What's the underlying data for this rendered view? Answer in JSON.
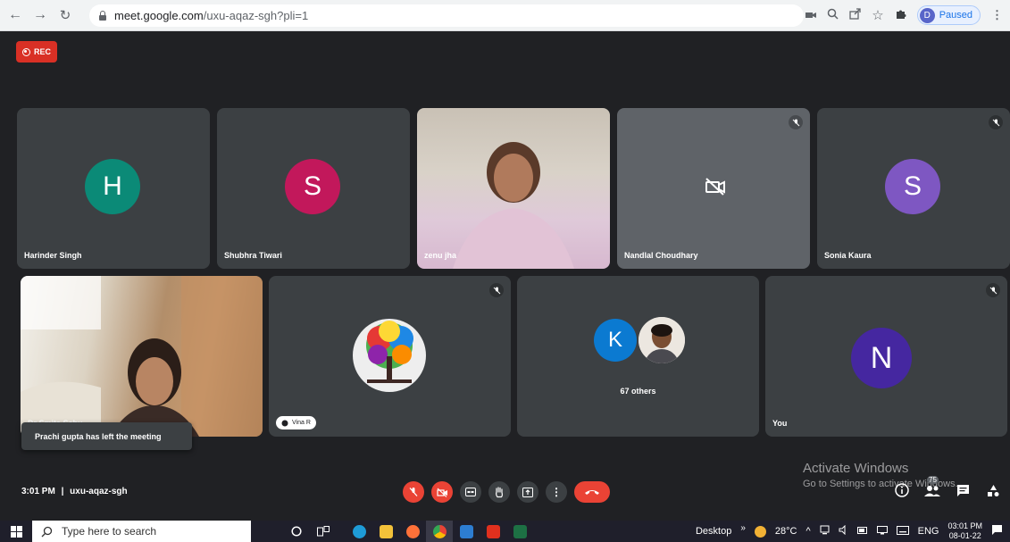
{
  "browser": {
    "url_host": "meet.google.com",
    "url_path": "/uxu-aqaz-sgh?pli=1",
    "profile_initial": "D",
    "profile_status": "Paused"
  },
  "meet": {
    "rec_label": "REC",
    "participants": [
      {
        "name": "Harinder Singh",
        "initial": "H",
        "avatar_color": "#0b8a77"
      },
      {
        "name": "Shubhra Tiwari",
        "initial": "S",
        "avatar_color": "#c2185b"
      },
      {
        "name": "zenu jha"
      },
      {
        "name": "Nandlal Choudhary"
      },
      {
        "name": "Sonia Kaura",
        "initial": "S",
        "avatar_color": "#7e57c2"
      },
      {
        "name": "Dr Smita Sahu"
      },
      {
        "name": "Vina R"
      },
      {
        "name": "67 others",
        "initial": "K",
        "avatar_color": "#0b7ad1"
      },
      {
        "name": "You",
        "initial": "N",
        "avatar_color": "#4527a0"
      }
    ],
    "toast": "Prachi gupta has left the meeting",
    "time": "3:01 PM",
    "separator": "|",
    "meeting_code": "uxu-aqaz-sgh",
    "participant_count": "75"
  },
  "watermark": {
    "line1": "Activate Windows",
    "line2": "Go to Settings to activate Windows."
  },
  "taskbar": {
    "search_placeholder": "Type here to search",
    "desktop_label": "Desktop",
    "weather": "28°C",
    "language": "ENG",
    "clock_time": "03:01 PM",
    "clock_date": "08-01-22"
  }
}
